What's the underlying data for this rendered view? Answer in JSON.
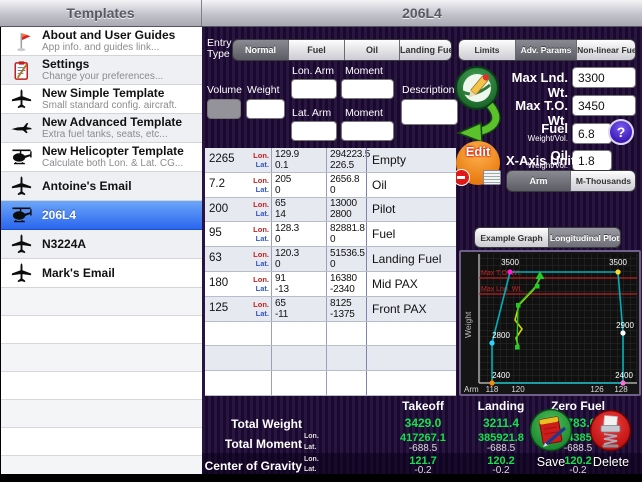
{
  "header": {
    "left_title": "Templates",
    "right_title": "206L4"
  },
  "sidebar": {
    "items": [
      {
        "icon": "flag-icon",
        "label": "About and User Guides",
        "sub": "App info. and guides link..."
      },
      {
        "icon": "clipboard-icon",
        "label": "Settings",
        "sub": "Change your preferences..."
      },
      {
        "icon": "airplane-icon",
        "label": "New Simple Template",
        "sub": "Small standard config. aircraft."
      },
      {
        "icon": "jet-icon",
        "label": "New Advanced Template",
        "sub": "Extra fuel tanks, seats, etc..."
      },
      {
        "icon": "helicopter-icon",
        "label": "New Helicopter Template",
        "sub": "Calculate both Lon. & Lat. CG..."
      },
      {
        "icon": "airplane-icon",
        "label": "Antoine's Email",
        "sub": ""
      },
      {
        "icon": "helicopter-icon",
        "label": "206L4",
        "sub": "",
        "selected": true
      },
      {
        "icon": "airplane-icon",
        "label": "N3224A",
        "sub": ""
      },
      {
        "icon": "airplane-icon",
        "label": "Mark's Email",
        "sub": ""
      }
    ]
  },
  "entry": {
    "label": "Entry Type",
    "tabs": [
      "Normal",
      "Fuel",
      "Oil",
      "Landing Fuel"
    ],
    "selected_tab": "Normal",
    "adv_tabs": [
      "Limits",
      "Adv. Params",
      "Non-linear Fuel"
    ],
    "selected_adv_tab": "Adv. Params",
    "fields": {
      "volume": "Volume",
      "weight": "Weight",
      "lon_arm": "Lon. Arm",
      "moment_top": "Moment",
      "lat_arm": "Lat. Arm",
      "moment_bottom": "Moment",
      "description": "Description"
    }
  },
  "params": {
    "max_lnd": {
      "label": "Max Lnd. Wt.",
      "value": "3300"
    },
    "max_to": {
      "label": "Max T.O. Wt.",
      "value": "3450"
    },
    "fuel": {
      "label": "Fuel",
      "unit": "Weight/Vol.",
      "value": "6.8"
    },
    "oil": {
      "label": "Oil",
      "unit": "Weight/Vol.",
      "value": "1.8"
    },
    "help": "?",
    "edit": "Edit",
    "xaxis": {
      "label": "X-Axis Unit",
      "options": [
        "Arm",
        "M-Thousands"
      ],
      "selected": "Arm"
    }
  },
  "graph": {
    "view_tabs": [
      "Example Graph",
      "Longitudinal Plot!"
    ],
    "selected_view": "Longitudinal Plot!"
  },
  "chart_data": {
    "type": "line",
    "title": "Longitudinal Plot",
    "xlabel": "Arm",
    "ylabel": "Weight",
    "x_ticks": [
      "118",
      "120",
      "126",
      "128"
    ],
    "envelope": {
      "x": [
        118,
        118,
        119.4,
        126.3,
        128,
        128
      ],
      "y": [
        2400,
        2800,
        3500,
        3500,
        2900,
        2400
      ]
    },
    "point_labels": [
      "2400",
      "2800",
      "3500",
      "3500",
      "2900",
      "2400"
    ],
    "limit_lines": [
      {
        "label": "Max T.O. Wt.",
        "value": 3450
      },
      {
        "label": "Max Lnd. Wt.",
        "value": 3300
      }
    ],
    "loading_path": [
      {
        "name": "Zero Fuel",
        "x": 120.2,
        "y": 2783.0
      },
      {
        "name": "Landing",
        "x": 120.2,
        "y": 3211.4
      },
      {
        "name": "Takeoff",
        "x": 121.7,
        "y": 3429.0
      }
    ]
  },
  "table": {
    "lon_label": "Lon.",
    "lat_label": "Lat.",
    "rows": [
      {
        "weight": "2265",
        "lon_arm": "129.9",
        "lat_arm": "0.1",
        "lon_moment": "294223.5",
        "lat_moment": "226.5",
        "desc": "Empty"
      },
      {
        "weight": "7.2",
        "lon_arm": "205",
        "lat_arm": "0",
        "lon_moment": "2656.8",
        "lat_moment": "0",
        "desc": "Oil"
      },
      {
        "weight": "200",
        "lon_arm": "65",
        "lat_arm": "14",
        "lon_moment": "13000",
        "lat_moment": "2800",
        "desc": "Pilot"
      },
      {
        "weight": "95",
        "lon_arm": "128.3",
        "lat_arm": "0",
        "lon_moment": "82881.8",
        "lat_moment": "0",
        "desc": "Fuel"
      },
      {
        "weight": "63",
        "lon_arm": "120.3",
        "lat_arm": "0",
        "lon_moment": "51536.5",
        "lat_moment": "0",
        "desc": "Landing Fuel"
      },
      {
        "weight": "180",
        "lon_arm": "91",
        "lat_arm": "-13",
        "lon_moment": "16380",
        "lat_moment": "-2340",
        "desc": "Mid PAX"
      },
      {
        "weight": "125",
        "lon_arm": "65",
        "lat_arm": "-11",
        "lon_moment": "8125",
        "lat_moment": "-1375",
        "desc": "Front PAX"
      }
    ]
  },
  "totals": {
    "columns": [
      "Takeoff",
      "Landing",
      "Zero Fuel"
    ],
    "weight_label": "Total Weight",
    "moment_label": "Total Moment",
    "cg_label": "Center  of Gravity",
    "lon_label": "Lon.",
    "lat_label": "Lat.",
    "weights": [
      "3429.0",
      "3211.4",
      "2783.0"
    ],
    "moments_lon": [
      "417267.1",
      "385921.8",
      "334385.3"
    ],
    "moments_lat": [
      "-688.5",
      "-688.5",
      "-688.5"
    ],
    "cg_lon": [
      "121.7",
      "120.2",
      "120.2"
    ],
    "cg_lat": [
      "-0.2",
      "-0.2",
      "-0.2"
    ]
  },
  "actions": {
    "save": "Save",
    "delete": "Delete"
  }
}
